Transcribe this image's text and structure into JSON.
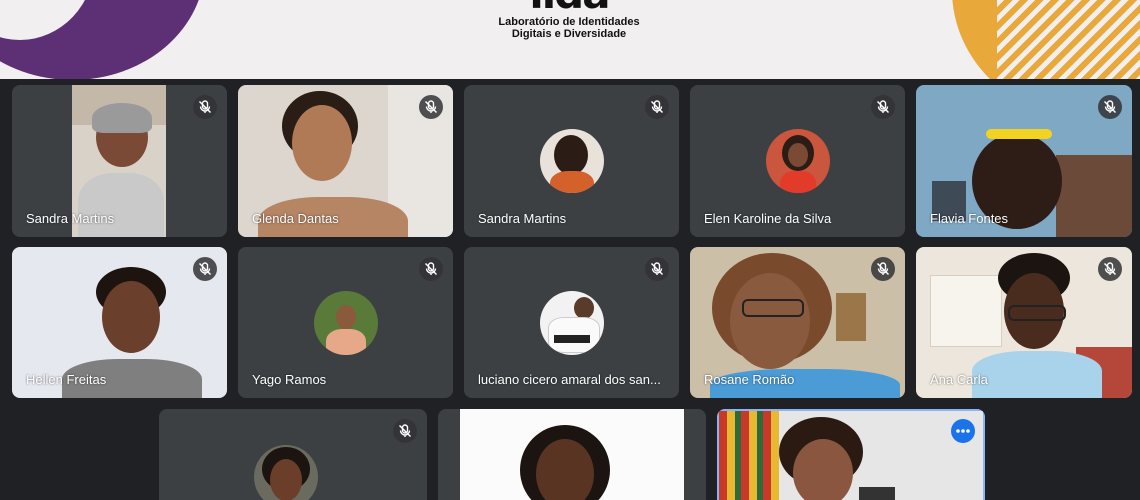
{
  "banner": {
    "logo_mark": "lida",
    "logo_line1": "Laboratório de Identidades",
    "logo_line2": "Digitais e Diversidade",
    "colors": {
      "purple": "#5d2f74",
      "yellow": "#e8a83a",
      "background": "#f1efef"
    }
  },
  "meeting": {
    "tile_background": "#3c4043",
    "participants": [
      {
        "name": "Sandra Martins",
        "muted": true,
        "view": "video"
      },
      {
        "name": "Glenda Dantas",
        "muted": true,
        "view": "video"
      },
      {
        "name": "Sandra Martins",
        "muted": true,
        "view": "avatar"
      },
      {
        "name": "Elen Karoline da Silva",
        "muted": true,
        "view": "avatar"
      },
      {
        "name": "Flavia Fontes",
        "muted": true,
        "view": "video"
      },
      {
        "name": "Hellen Freitas",
        "muted": true,
        "view": "video"
      },
      {
        "name": "Yago Ramos",
        "muted": true,
        "view": "avatar"
      },
      {
        "name": "luciano cicero amaral dos san...",
        "muted": true,
        "view": "avatar"
      },
      {
        "name": "Rosane Romão",
        "muted": true,
        "view": "video"
      },
      {
        "name": "Ana Carla",
        "muted": true,
        "view": "video"
      },
      {
        "name": "",
        "muted": true,
        "view": "avatar"
      },
      {
        "name": "",
        "muted": false,
        "view": "video"
      },
      {
        "name": "",
        "muted": false,
        "view": "video",
        "highlighted": true,
        "highlight_color": "#8ab4f8"
      }
    ]
  }
}
